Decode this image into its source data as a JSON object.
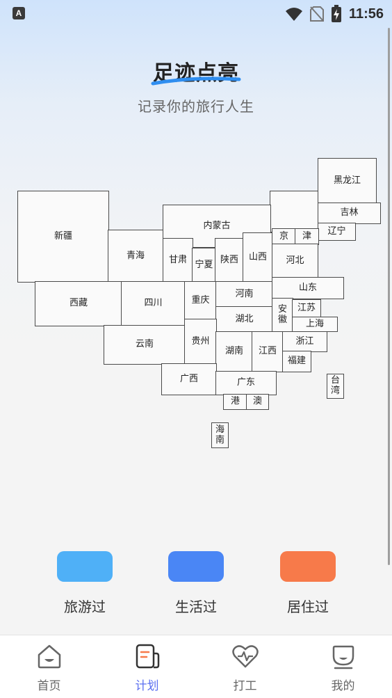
{
  "status_bar": {
    "app_icon_letter": "A",
    "time": "11:56"
  },
  "header": {
    "title": "足迹点亮",
    "subtitle": "记录你的旅行人生"
  },
  "regions": {
    "xinjiang": "新疆",
    "xizang": "西藏",
    "qinghai": "青海",
    "gansu": "甘肃",
    "ningxia": "宁夏",
    "neimenggu": "内蒙古",
    "shaanxi": "陕西",
    "shanxi": "山西",
    "heilongjiang": "黑龙江",
    "jilin": "吉林",
    "liaoning": "辽宁",
    "beijing": "京",
    "tianjin": "津",
    "hebei": "河北",
    "shandong": "山东",
    "henan": "河南",
    "sichuan": "四川",
    "chongqing": "重庆",
    "hubei": "湖北",
    "anhui_1": "安",
    "anhui_2": "徽",
    "jiangsu": "江苏",
    "shanghai": "上海",
    "yunnan": "云南",
    "guizhou": "贵州",
    "hunan": "湖南",
    "jiangxi": "江西",
    "zhejiang": "浙江",
    "fujian": "福建",
    "guangxi": "广西",
    "guangdong": "广东",
    "taiwan_1": "台",
    "taiwan_2": "湾",
    "hongkong": "港",
    "macau": "澳",
    "hainan_1": "海",
    "hainan_2": "南"
  },
  "legend": [
    {
      "label": "旅游过",
      "color": "#4fb0f7"
    },
    {
      "label": "生活过",
      "color": "#4a86f5"
    },
    {
      "label": "居住过",
      "color": "#f77a4a"
    }
  ],
  "tabs": [
    {
      "label": "首页",
      "icon": "home-icon",
      "active": false
    },
    {
      "label": "计划",
      "icon": "plan-icon",
      "active": true
    },
    {
      "label": "打工",
      "icon": "heartbeat-icon",
      "active": false
    },
    {
      "label": "我的",
      "icon": "profile-icon",
      "active": false
    }
  ],
  "colors": {
    "accent": "#5b6ff0",
    "underline": "#2f8ef0"
  }
}
